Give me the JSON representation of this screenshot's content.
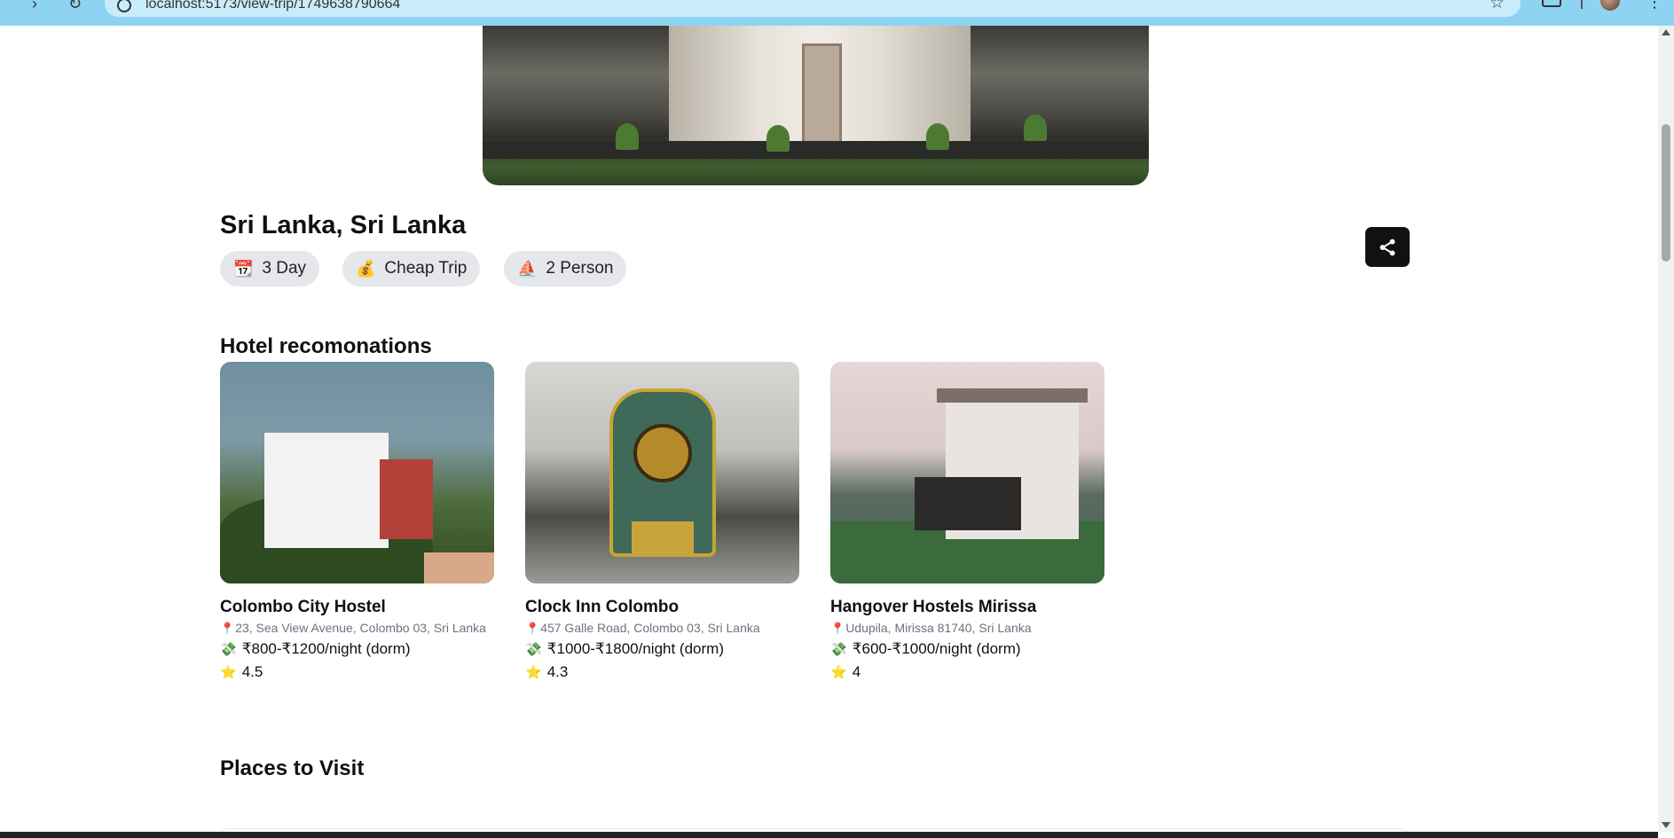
{
  "browser": {
    "url": "localhost:5173/view-trip/1749638790664",
    "back_glyph": "›",
    "reload_glyph": "↻",
    "bookmark_glyph": "☆",
    "menu_glyph": "⋮"
  },
  "trip": {
    "title": "Sri Lanka, Sri Lanka",
    "chips": [
      {
        "icon": "📆",
        "label": "3 Day"
      },
      {
        "icon": "💰",
        "label": "Cheap Trip"
      },
      {
        "icon": "⛵",
        "label": "2 Person"
      }
    ],
    "share_icon": "share-icon"
  },
  "hotels": {
    "heading": "Hotel recomonations",
    "items": [
      {
        "name": "Colombo City Hostel",
        "address": "23, Sea View Avenue, Colombo 03, Sri Lanka",
        "price": "₹800-₹1200/night (dorm)",
        "rating": "4.5"
      },
      {
        "name": "Clock Inn Colombo",
        "address": "457 Galle Road, Colombo 03, Sri Lanka",
        "price": "₹1000-₹1800/night (dorm)",
        "rating": "4.3"
      },
      {
        "name": "Hangover Hostels Mirissa",
        "address": "Udupila, Mirissa 81740, Sri Lanka",
        "price": "₹600-₹1000/night (dorm)",
        "rating": "4"
      }
    ]
  },
  "places": {
    "heading": "Places to Visit"
  },
  "glyphs": {
    "pin": "📍",
    "money": "💸",
    "star": "⭐"
  }
}
